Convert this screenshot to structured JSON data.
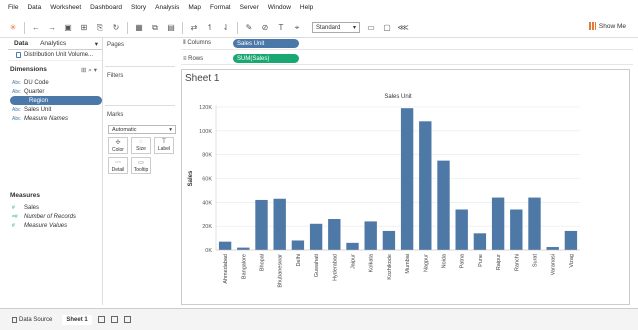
{
  "menu": [
    "File",
    "Data",
    "Worksheet",
    "Dashboard",
    "Story",
    "Analysis",
    "Map",
    "Format",
    "Server",
    "Window",
    "Help"
  ],
  "toolbar": {
    "fit_select": "Standard",
    "show_me": "Show Me",
    "icons": [
      "tableau-logo-icon",
      "undo-icon",
      "redo-icon",
      "save-icon",
      "new-data-source-icon",
      "pause-icon",
      "refresh-icon",
      "new-worksheet-icon",
      "duplicate-icon",
      "clear-icon",
      "swap-icon",
      "sort-ascending-icon",
      "sort-descending-icon",
      "highlight-icon",
      "group-icon",
      "label-icon",
      "fix-axes-icon",
      "fit-icon",
      "presentation-icon",
      "share-icon"
    ]
  },
  "data_pane": {
    "tabs": [
      "Data",
      "Analytics"
    ],
    "data_source": "Distribution Unit Volume...",
    "dimensions_title": "Dimensions",
    "dimensions": [
      {
        "type": "Abc",
        "name": "DU Code"
      },
      {
        "type": "Abc",
        "name": "Quarter"
      },
      {
        "type": "⊕",
        "name": "Region"
      },
      {
        "type": "Abc",
        "name": "Sales Unit"
      },
      {
        "type": "Abc",
        "name": "Measure Names"
      }
    ],
    "measures_title": "Measures",
    "measures": [
      {
        "type": "#",
        "name": "Sales"
      },
      {
        "type": "=#",
        "name": "Number of Records"
      },
      {
        "type": "#",
        "name": "Measure Values"
      }
    ]
  },
  "cards": {
    "pages": "Pages",
    "filters": "Filters",
    "marks": "Marks",
    "marks_type": "Automatic",
    "mark_buttons": [
      {
        "icon": "✣",
        "label": "Color"
      },
      {
        "icon": "◌",
        "label": "Size"
      },
      {
        "icon": "T",
        "label": "Label"
      },
      {
        "icon": "⋯",
        "label": "Detail"
      },
      {
        "icon": "▭",
        "label": "Tooltip"
      }
    ]
  },
  "shelves": {
    "columns_label": "Columns",
    "columns_pill": "Sales Unit",
    "rows_label": "Rows",
    "rows_pill": "SUM(Sales)"
  },
  "sheet": {
    "title": "Sheet 1"
  },
  "chart_data": {
    "type": "bar",
    "title": "Sales Unit",
    "xlabel": "",
    "ylabel": "Sales",
    "ylim": [
      0,
      120000
    ],
    "yticks": [
      "0K",
      "20K",
      "40K",
      "60K",
      "80K",
      "100K",
      "120K"
    ],
    "bar_color": "#4e79a7",
    "categories": [
      "Ahmedabad",
      "Bangalore",
      "Bhopal",
      "Bhubaneswar",
      "Delhi",
      "Guwahati",
      "Hyderabad",
      "Jaipur",
      "Kolkata",
      "Kozhikode",
      "Mumbai",
      "Nagpur",
      "Noida",
      "Patna",
      "Pune",
      "Raipur",
      "Ranchi",
      "Surat",
      "Varanasi",
      "Vizag"
    ],
    "values": [
      7000,
      2000,
      42000,
      43000,
      8000,
      22000,
      26000,
      6000,
      24000,
      16000,
      119000,
      108000,
      75000,
      34000,
      14000,
      44000,
      34000,
      44000,
      2500,
      16000
    ]
  },
  "status": {
    "tabs": [
      "Data Source",
      "Sheet 1"
    ]
  }
}
